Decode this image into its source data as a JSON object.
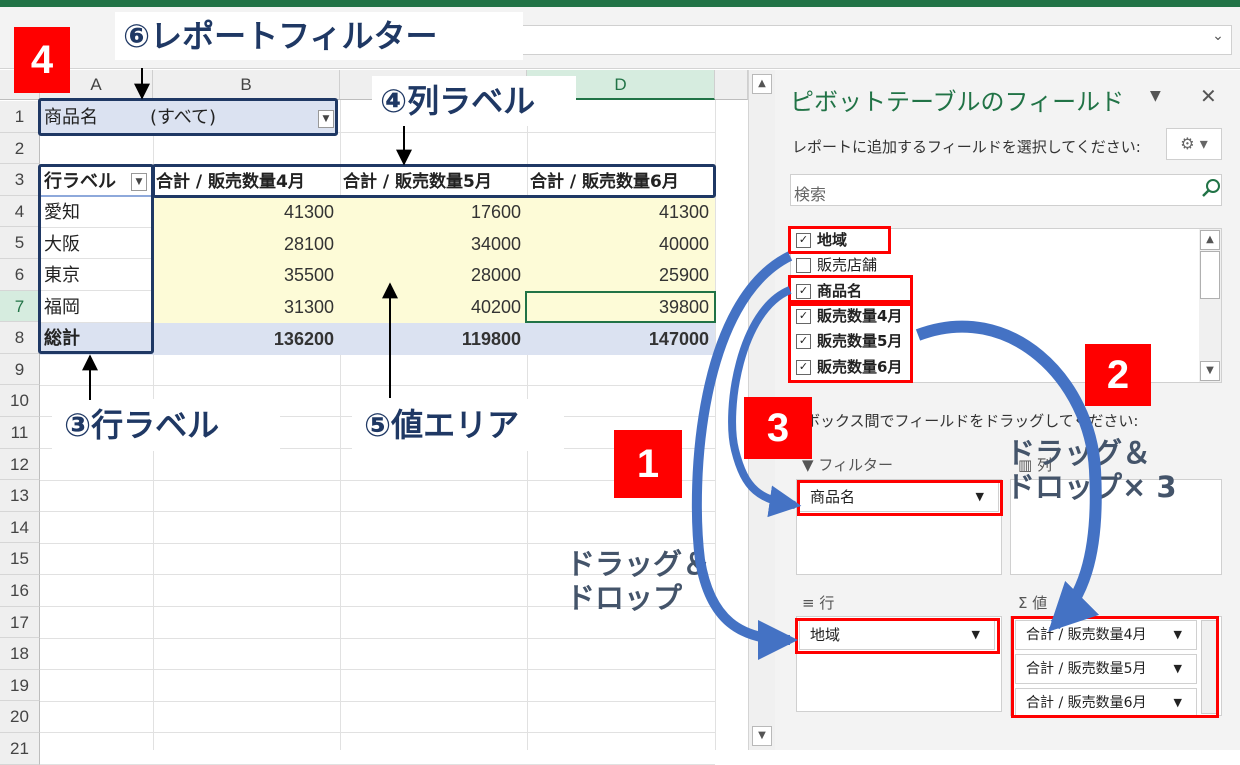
{
  "excel": {
    "columns": [
      "A",
      "B",
      "",
      "D"
    ],
    "rows": [
      "1",
      "2",
      "3",
      "4",
      "5",
      "6",
      "7",
      "8",
      "9",
      "10",
      "11",
      "12",
      "13",
      "14",
      "15",
      "16",
      "17",
      "18",
      "19",
      "20",
      "21"
    ]
  },
  "pivot": {
    "filter_label": "商品名",
    "filter_value": "(すべて)",
    "row_header": "行ラベル",
    "col_headers": [
      "合計 / 販売数量4月",
      "合計 / 販売数量5月",
      "合計 / 販売数量6月"
    ],
    "rows": [
      {
        "label": "愛知",
        "values": [
          "41300",
          "17600",
          "41300"
        ]
      },
      {
        "label": "大阪",
        "values": [
          "28100",
          "34000",
          "40000"
        ]
      },
      {
        "label": "東京",
        "values": [
          "35500",
          "28000",
          "25900"
        ]
      },
      {
        "label": "福岡",
        "values": [
          "31300",
          "40200",
          "39800"
        ]
      }
    ],
    "total": {
      "label": "総計",
      "values": [
        "136200",
        "119800",
        "147000"
      ]
    }
  },
  "pane": {
    "title": "ピボットテーブルのフィールド",
    "subtitle": "レポートに追加するフィールドを選択してください:",
    "search_placeholder": "検索",
    "fields": [
      {
        "label": "地域",
        "checked": "✓"
      },
      {
        "label": "販売店舗",
        "checked": ""
      },
      {
        "label": "商品名",
        "checked": "✓"
      },
      {
        "label": "販売数量4月",
        "checked": "✓"
      },
      {
        "label": "販売数量5月",
        "checked": "✓"
      },
      {
        "label": "販売数量6月",
        "checked": "✓"
      }
    ],
    "drag_instruction": "のボックス間でフィールドをドラッグしてください:",
    "filter_area": {
      "header": "フィルター",
      "items": [
        "商品名"
      ]
    },
    "column_area": {
      "header": "列"
    },
    "row_area": {
      "header": "行",
      "items": [
        "地域"
      ]
    },
    "value_area": {
      "header": "値",
      "items": [
        "合計 / 販売数量4月",
        "合計 / 販売数量5月",
        "合計 / 販売数量6月"
      ]
    }
  },
  "annotations": {
    "badges": [
      "4",
      "1",
      "2",
      "3"
    ],
    "report_filter": "⑥レポートフィルター",
    "column_label": "④列ラベル",
    "row_label": "③行ラベル",
    "value_area": "⑤値エリア",
    "drag_drop": "ドラッグ＆\nドロップ",
    "drag_drop_x3_l1": "ドラッグ＆",
    "drag_drop_x3_l2": "ドロップ× 3",
    "drag_drop_l1": "ドラッグ＆",
    "drag_drop_l2": "ドロップ"
  },
  "colors": {
    "excel_green": "#217346",
    "annotation_red": "#ff0000",
    "annotation_navy": "#1f3864",
    "arrow_blue": "#4472c4"
  }
}
